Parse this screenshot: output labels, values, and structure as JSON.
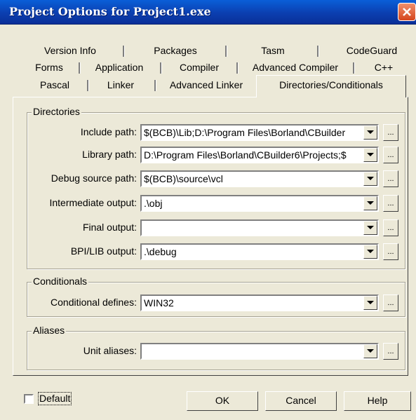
{
  "window": {
    "title": "Project Options for Project1.exe"
  },
  "tabs": {
    "row1": [
      "Version Info",
      "Packages",
      "Tasm",
      "CodeGuard"
    ],
    "row2": [
      "Forms",
      "Application",
      "Compiler",
      "Advanced Compiler",
      "C++"
    ],
    "row3": [
      "Pascal",
      "Linker",
      "Advanced Linker"
    ],
    "active": "Directories/Conditionals"
  },
  "directories": {
    "title": "Directories",
    "include": {
      "label": "Include path:",
      "value": "$(BCB)\\Lib;D:\\Program Files\\Borland\\CBuilder"
    },
    "library": {
      "label": "Library path:",
      "value": "D:\\Program Files\\Borland\\CBuilder6\\Projects;$"
    },
    "debug_source": {
      "label": "Debug source path:",
      "value": "$(BCB)\\source\\vcl"
    },
    "intermediate": {
      "label": "Intermediate output:",
      "value": ".\\obj"
    },
    "final": {
      "label": "Final output:",
      "value": ""
    },
    "bpi_lib": {
      "label": "BPI/LIB output:",
      "value": ".\\debug"
    }
  },
  "conditionals": {
    "title": "Conditionals",
    "defines": {
      "label": "Conditional defines:",
      "value": "WIN32"
    }
  },
  "aliases": {
    "title": "Aliases",
    "unit": {
      "label": "Unit aliases:",
      "value": ""
    }
  },
  "ellipsis": "...",
  "footer": {
    "default_label": "Default",
    "ok": "OK",
    "cancel": "Cancel",
    "help": "Help"
  }
}
